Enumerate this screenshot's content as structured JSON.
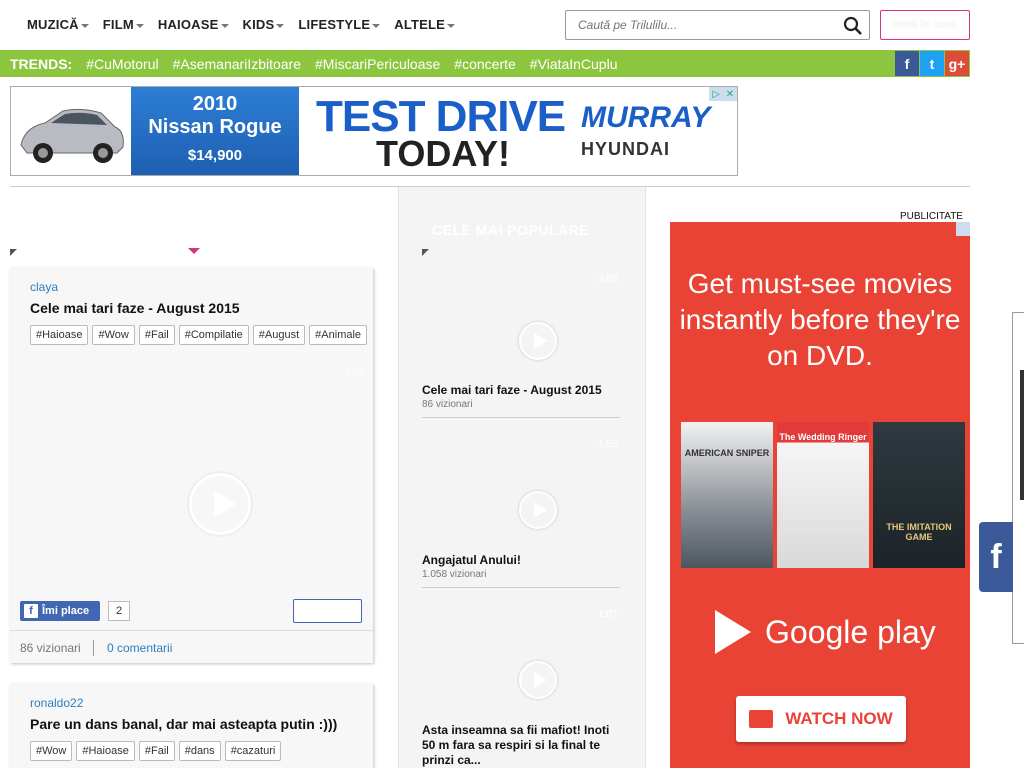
{
  "nav": {
    "menu": [
      "MUZICĂ",
      "FILM",
      "HAIOASE",
      "KIDS",
      "LIFESTYLE",
      "ALTELE"
    ],
    "search_placeholder": "Caută pe Trilulilu...",
    "login_label": "Intră în cont"
  },
  "trends": {
    "label": "TRENDS:",
    "items": [
      "#CuMotorul",
      "#AsemanariIzbitoare",
      "#MiscariPericuloase",
      "#concerte",
      "#ViataInCuplu"
    ]
  },
  "social": {
    "facebook": "f",
    "twitter": "t",
    "googleplus": "g+"
  },
  "top_ad": {
    "year": "2010",
    "model": "Nissan Rogue",
    "price": "$14,900",
    "line1": "TEST DRIVE",
    "line2": "TODAY!",
    "brand": "MURRAY",
    "brand2": "HYUNDAI"
  },
  "feed": [
    {
      "user": "claya",
      "title": "Cele mai tari faze - August 2015",
      "tags": [
        "#Haioase",
        "#Wow",
        "#Fail",
        "#Compilatie",
        "#August",
        "#Animale"
      ],
      "duration": "3:03",
      "like_label": "Îmi place",
      "like_count": "2",
      "views": "86 vizionari",
      "comments": "0 comentarii"
    },
    {
      "user": "ronaldo22",
      "title": "Pare un dans banal, dar mai asteapta putin :)))",
      "tags": [
        "#Wow",
        "#Haioase",
        "#Fail",
        "#dans",
        "#cazaturi"
      ]
    }
  ],
  "popular": {
    "heading": "CELE MAI POPULARE",
    "items": [
      {
        "title": "Cele mai tari faze - August 2015",
        "views": "86 vizionari",
        "duration": "3:03"
      },
      {
        "title": "Angajatul Anului!",
        "views": "1.058 vizionari",
        "duration": "1:58"
      },
      {
        "title": "Asta inseamna sa fii mafiot! Inoti 50 m fara sa respiri si la final te prinzi ca...",
        "duration": "1:07"
      }
    ]
  },
  "right_ad": {
    "label": "PUBLICITATE",
    "headline": "Get must-see movies instantly before they're on DVD.",
    "posters": [
      "AMERICAN SNIPER",
      "The Wedding Ringer",
      "THE IMITATION GAME"
    ],
    "store": "Google play",
    "cta": "WATCH NOW"
  },
  "floating": {
    "fb": "f"
  }
}
